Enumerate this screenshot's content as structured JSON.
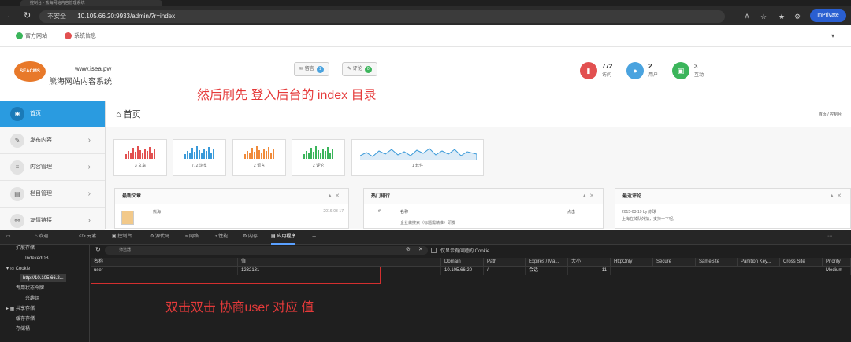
{
  "browser": {
    "tab_title": "控制台 - 熊海网站内容管理系统",
    "not_secure": "不安全",
    "url": "10.105.66.20:9933/admin/?r=index",
    "inprivate": "InPrivate"
  },
  "topnav": {
    "link1": "官方网站",
    "link2": "系统信息",
    "user_icon": "user-icon"
  },
  "header": {
    "logo_text": "SEACMS",
    "domain": "www.isea.pw",
    "site_name": "熊海网站内容系统",
    "btn_message": {
      "label": "留言",
      "count": "1"
    },
    "btn_comment": {
      "label": "评论",
      "count": "0"
    },
    "stats": [
      {
        "value": "772",
        "label": "访问",
        "color": "#e25050"
      },
      {
        "value": "2",
        "label": "用户",
        "color": "#4aa3df"
      },
      {
        "value": "3",
        "label": "互动",
        "color": "#3bb55b"
      }
    ]
  },
  "annotations": {
    "top": "然后刷先 登入后台的 index 目录",
    "bottom": "双击双击 协商user 对应 值"
  },
  "sidebar": {
    "items": [
      {
        "label": "首页",
        "active": true
      },
      {
        "label": "发布内容"
      },
      {
        "label": "内容管理"
      },
      {
        "label": "栏目管理"
      },
      {
        "label": "友情链接"
      }
    ]
  },
  "page": {
    "title": "首页",
    "breadcrumb": "首页 / 控制台"
  },
  "mini_cards": [
    {
      "label": "3 文章",
      "color": "#e25050"
    },
    {
      "label": "772 浏览",
      "color": "#3a9ad9"
    },
    {
      "label": "2 留言",
      "color": "#f08a3a"
    },
    {
      "label": "2 评论",
      "color": "#3bb55b"
    },
    {
      "label": "1 软件",
      "color": "#3a9ad9"
    }
  ],
  "panels": {
    "latest_articles": "最新文章",
    "article_author": "熊海",
    "article_date": "2016-03-17",
    "hot_ranking": "热门排行",
    "rank_col_index": "#",
    "rank_col_name": "名称",
    "rank_col_clicks": "点击",
    "rank_row_text": "企业做搜索（标题需精准）研发",
    "recent_comments": "最近评论",
    "comment_meta": "2015-03-19 by 赤球",
    "comment_text": "上海在掉队外抽，支持一下呢。"
  },
  "devtools": {
    "tabs": [
      "欢迎",
      "元素",
      "控制台",
      "源代码",
      "网络",
      "性能",
      "内存",
      "应用程序"
    ],
    "active_tab": "应用程序",
    "tree": [
      "扩展存储",
      "IndexedDB",
      "Cookie",
      "http://10.105.66.2...",
      "专用状态令牌",
      "兴趣组",
      "共享存储",
      "缓存存储",
      "存储桶"
    ],
    "filter_placeholder": "筛选器",
    "only_issue_cookies": "仅显示有问题的 Cookie",
    "columns": [
      "名称",
      "值",
      "Domain",
      "Path",
      "Expires / Ma...",
      "大小",
      "HttpOnly",
      "Secure",
      "SameSite",
      "Partition Key...",
      "Cross Site",
      "Priority"
    ],
    "row": {
      "name": "user",
      "value": "1232131",
      "domain": "10.105.66.20",
      "path": "/",
      "expires": "会话",
      "size": "11",
      "priority": "Medium"
    }
  }
}
